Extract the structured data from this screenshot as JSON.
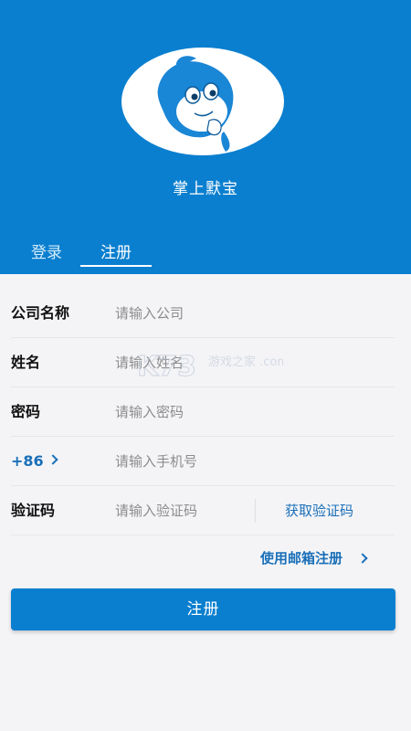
{
  "header": {
    "app_name": "掌上默宝",
    "tabs": [
      {
        "label": "登录",
        "active": false
      },
      {
        "label": "注册",
        "active": true
      }
    ],
    "colors": {
      "primary": "#0a7fcf",
      "link": "#1a6fb8"
    }
  },
  "form": {
    "company": {
      "label": "公司名称",
      "placeholder": "请输入公司"
    },
    "name": {
      "label": "姓名",
      "placeholder": "请输入姓名"
    },
    "password": {
      "label": "密码",
      "placeholder": "请输入密码"
    },
    "phone": {
      "country_code": "+86",
      "placeholder": "请输入手机号"
    },
    "code": {
      "label": "验证码",
      "placeholder": "请输入验证码",
      "get_code_label": "获取验证码"
    }
  },
  "email_register_label": "使用邮箱注册",
  "submit_label": "注册",
  "watermark_text": "游戏之家 .com"
}
